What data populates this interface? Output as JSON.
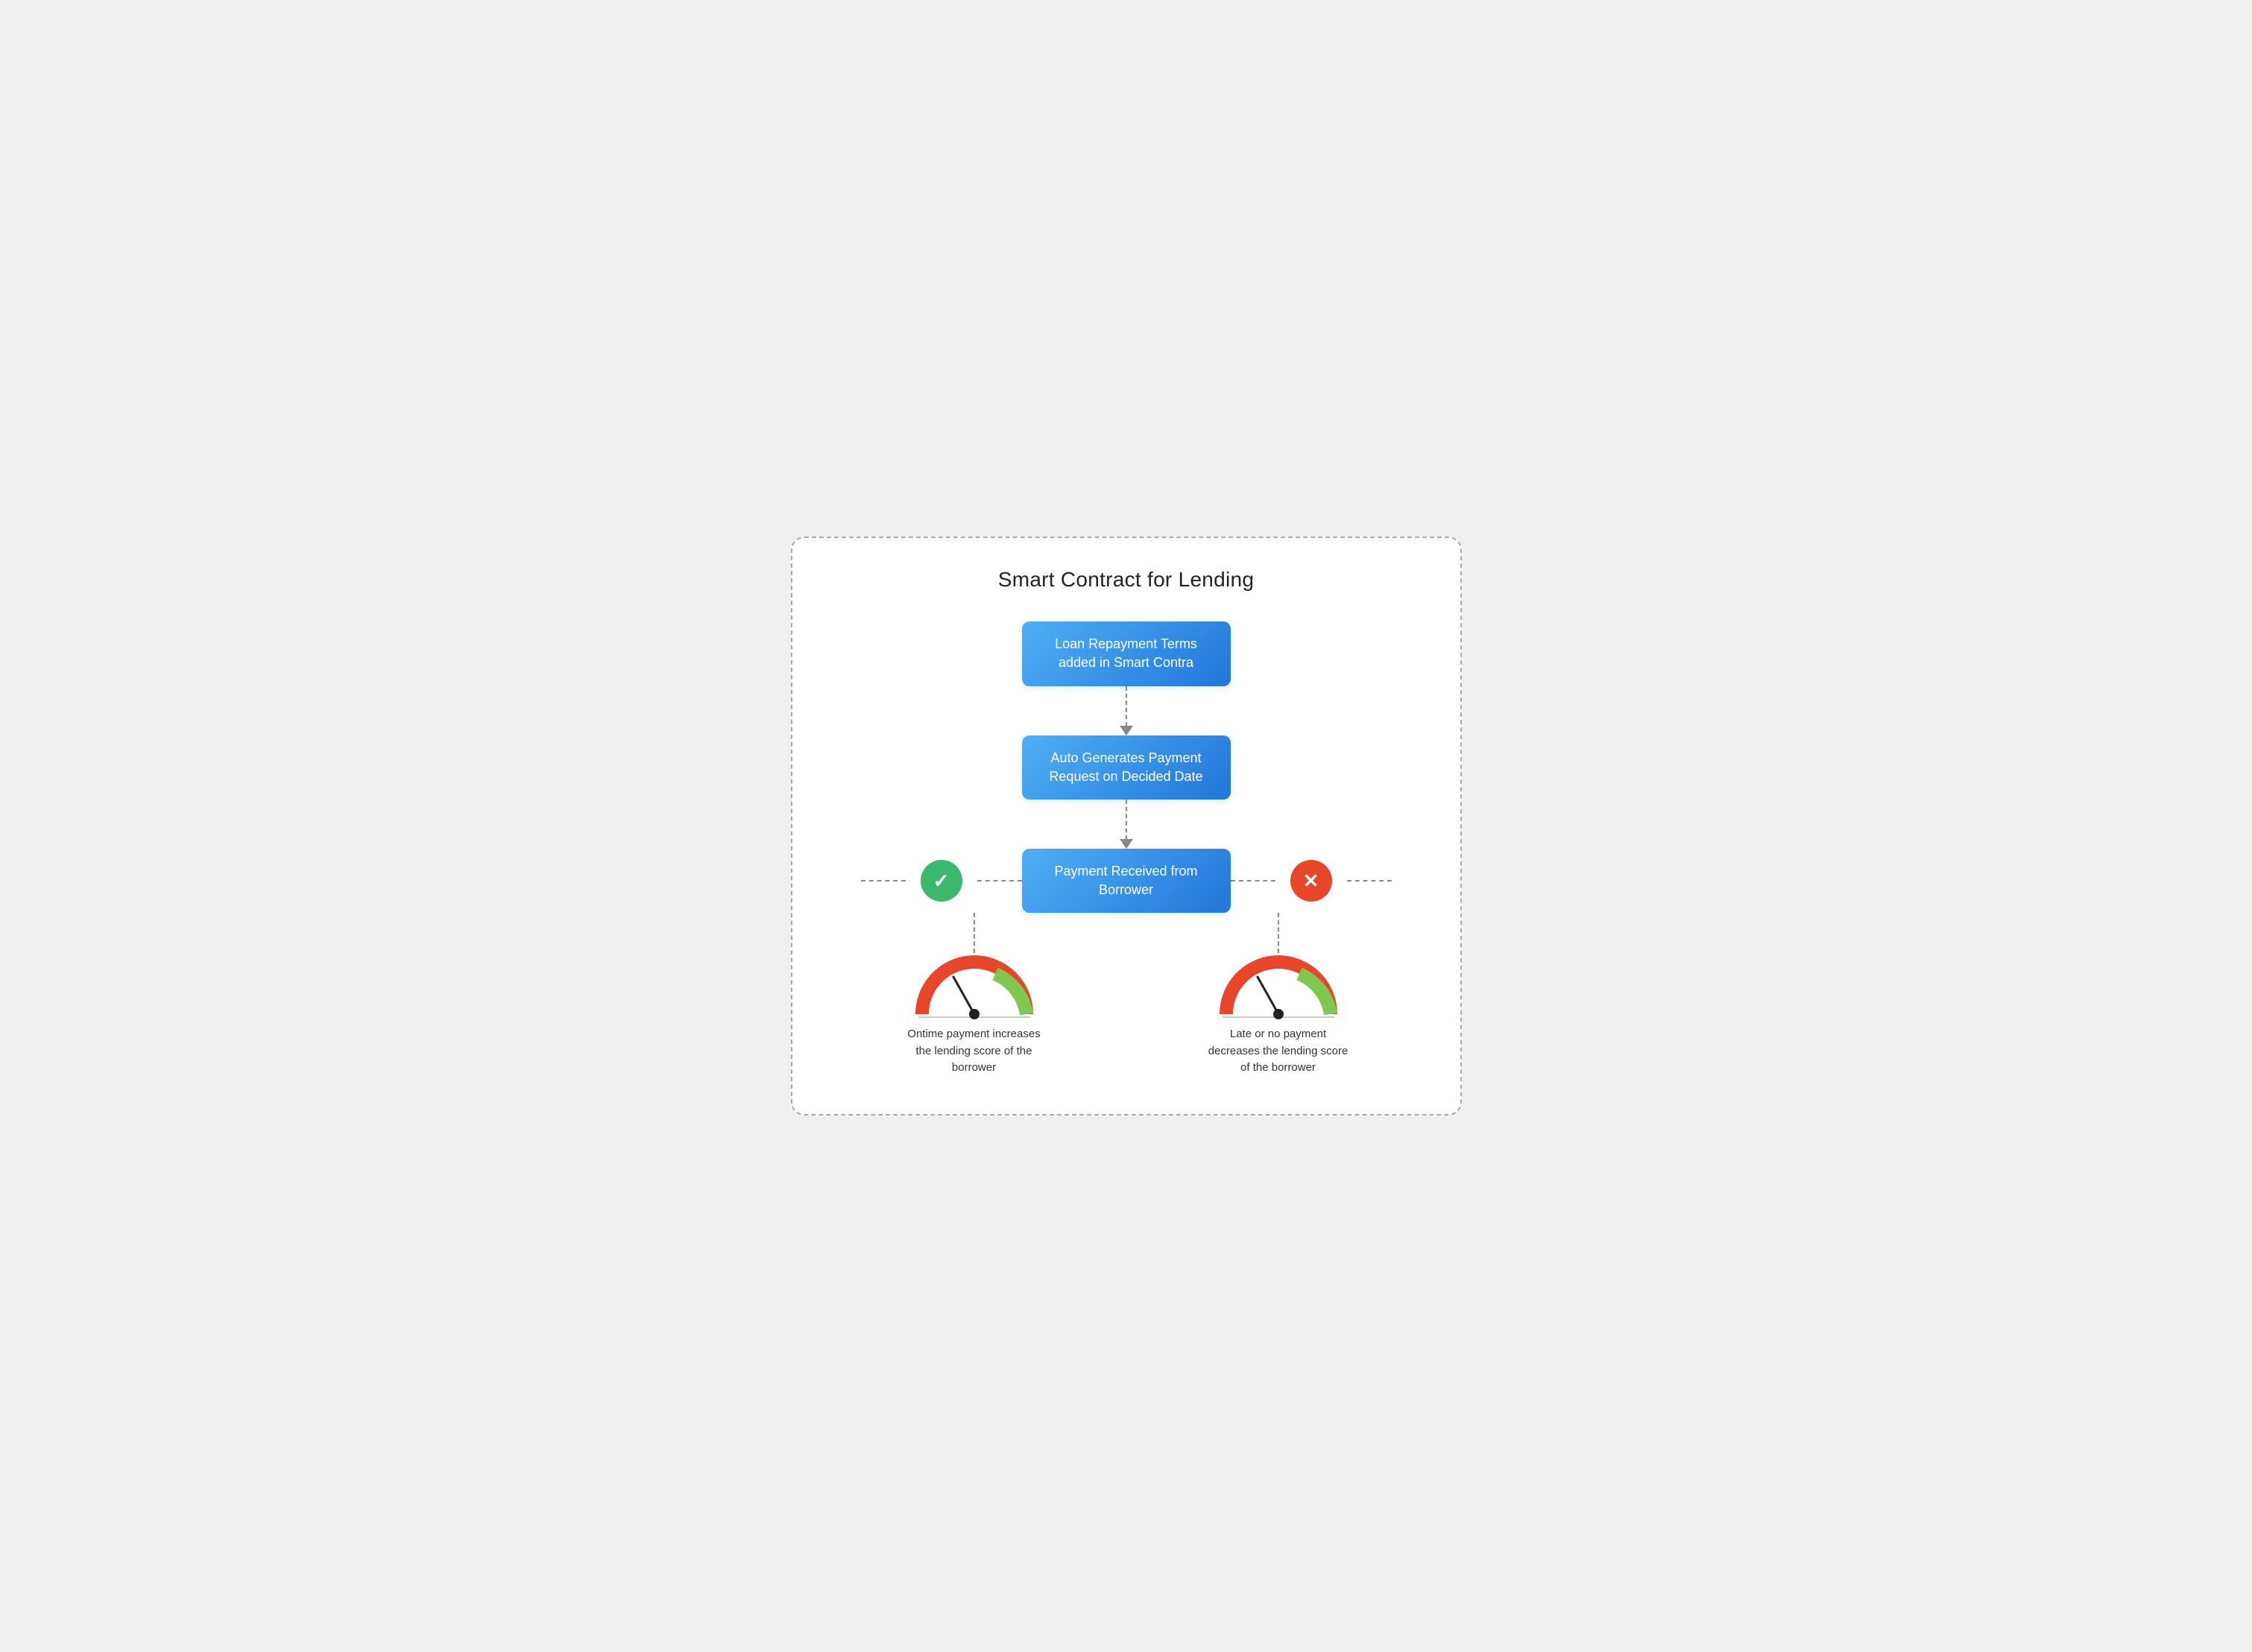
{
  "title": "Smart Contract for Lending",
  "boxes": {
    "box1": "Loan Repayment Terms added in Smart Contra",
    "box2": "Auto Generates Payment Request on Decided Date",
    "box3": "Payment Received from Borrower"
  },
  "icons": {
    "check": "✓",
    "x": "✕"
  },
  "labels": {
    "ontime": "Ontime payment increases the lending score of the borrower",
    "late": "Late or no payment decreases the lending score of the borrower"
  },
  "colors": {
    "box_gradient_start": "#5bb8f8",
    "box_gradient_end": "#2176d9",
    "check_bg": "#3cb96e",
    "x_bg": "#e8462a",
    "gauge_red": "#e8462a",
    "gauge_green": "#7ec850",
    "gauge_needle": "#222"
  }
}
